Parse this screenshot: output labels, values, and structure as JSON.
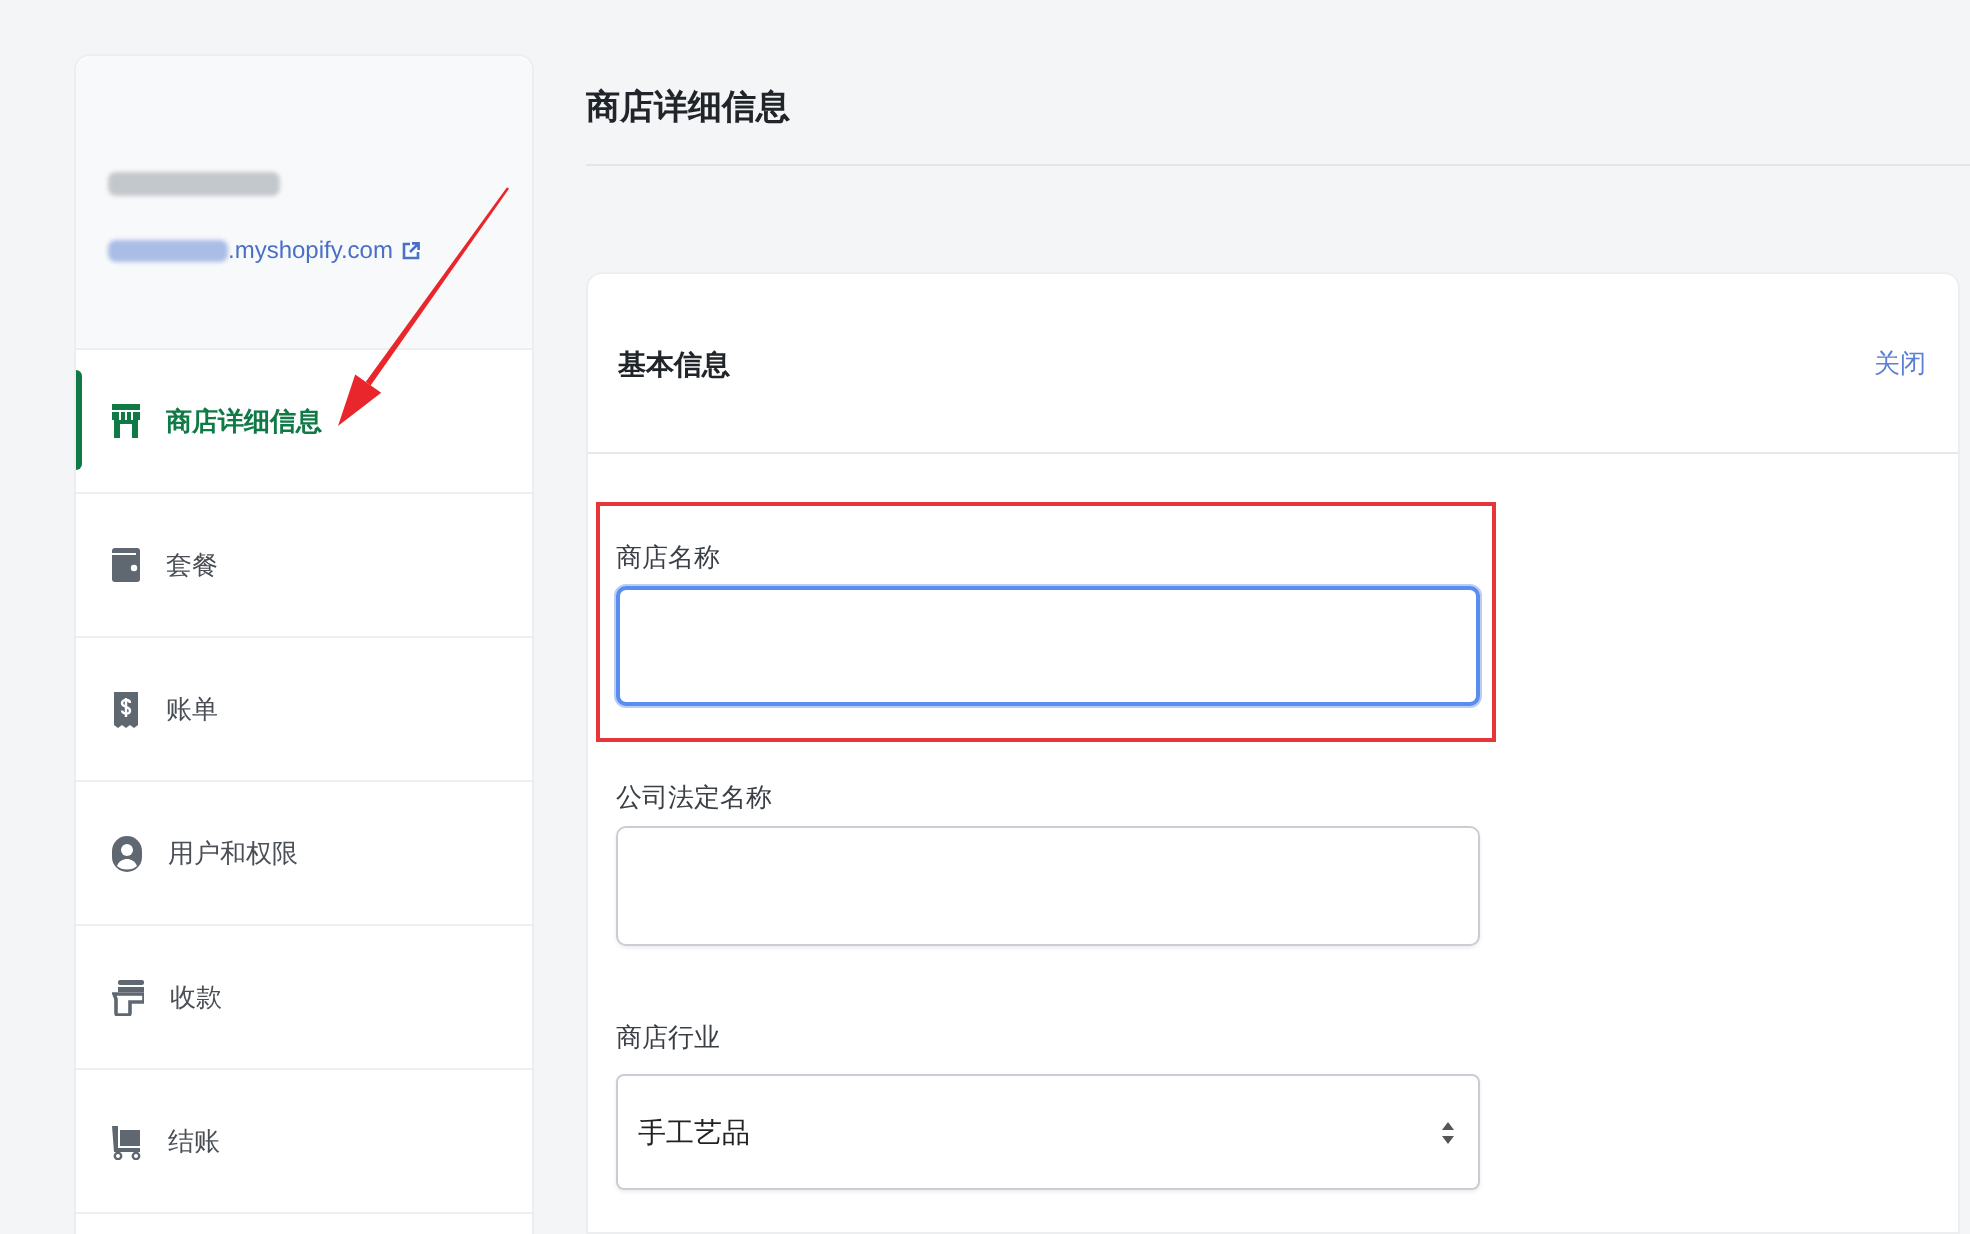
{
  "sidebar": {
    "store_url_suffix": ".myshopify.com",
    "items": [
      {
        "label": "商店详细信息",
        "selected": true,
        "annotated": true
      },
      {
        "label": "套餐",
        "selected": false,
        "annotated": false
      },
      {
        "label": "账单",
        "selected": false,
        "annotated": false
      },
      {
        "label": "用户和权限",
        "selected": false,
        "annotated": false
      },
      {
        "label": "收款",
        "selected": false,
        "annotated": false
      },
      {
        "label": "结账",
        "selected": false,
        "annotated": false
      }
    ]
  },
  "page_title": "商店详细信息",
  "card": {
    "title": "基本信息",
    "close_link": "关闭",
    "fields": [
      {
        "kind": "text",
        "label": "商店名称",
        "focused": true,
        "highlighted": true
      },
      {
        "kind": "text",
        "label": "公司法定名称",
        "focused": false,
        "highlighted": false
      },
      {
        "kind": "select",
        "label": "商店行业",
        "value": "手工艺品",
        "focused": false,
        "highlighted": false
      }
    ]
  }
}
